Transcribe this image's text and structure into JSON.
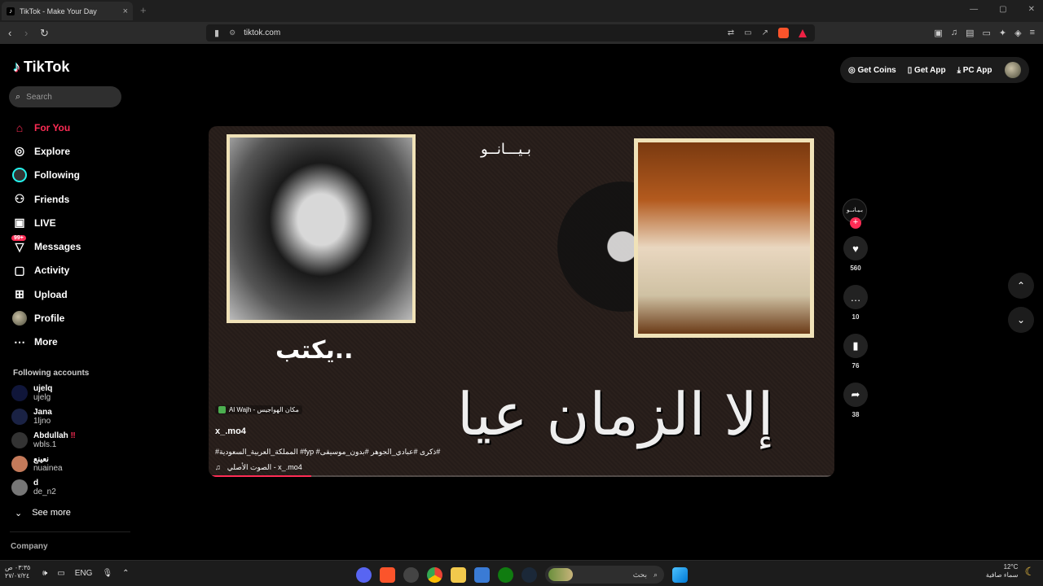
{
  "browser": {
    "tab_title": "TikTok - Make Your Day",
    "tab_favicon": "tiktok-icon",
    "url": "tiktok.com"
  },
  "site": {
    "logo_text": "TikTok",
    "search_placeholder": "Search",
    "nav": [
      {
        "label": "For You",
        "icon": "home-icon"
      },
      {
        "label": "Explore",
        "icon": "compass-icon"
      },
      {
        "label": "Following",
        "icon": "following-icon"
      },
      {
        "label": "Friends",
        "icon": "friends-icon"
      },
      {
        "label": "LIVE",
        "icon": "live-icon"
      },
      {
        "label": "Messages",
        "icon": "messages-icon",
        "badge": "99+"
      },
      {
        "label": "Activity",
        "icon": "activity-icon"
      },
      {
        "label": "Upload",
        "icon": "upload-icon"
      },
      {
        "label": "Profile",
        "icon": "profile-icon"
      },
      {
        "label": "More",
        "icon": "more-icon"
      }
    ],
    "following_heading": "Following accounts",
    "following": [
      {
        "name": "ujelq",
        "user": "ujelg"
      },
      {
        "name": "Jana",
        "user": "1ljno"
      },
      {
        "name": "Abdullah",
        "user": "wbls.1"
      },
      {
        "name": "نعينع",
        "user": "nuainea"
      },
      {
        "name": "d",
        "user": "de_n2"
      }
    ],
    "see_more": "See more",
    "company": "Company",
    "top_actions": {
      "coins": "Get Coins",
      "app": "Get App",
      "pc": "PC App"
    }
  },
  "video": {
    "overlay_small": "بـيـــانــو",
    "overlay_writes": "يكتب..",
    "overlay_big": "إلا الزمان عيا",
    "music_tag": "Al Wajh - مكان الهواجيس",
    "author": "x_.mo4",
    "caption": "#المملكة_العربية_السعودية #fyp #ذكرى #عبادي_الجوهر #بدون_موسيقى#",
    "sound": "الصوت الأصلي - x_.mo4",
    "progress": 0.16,
    "creator_badge": "بـيـانــو",
    "likes": "560",
    "comments": "10",
    "saves": "76",
    "shares": "38"
  },
  "taskbar": {
    "time": "٠٣:٣٥ ص",
    "date": "٢٧/٠٧/٢٤",
    "lang": "ENG",
    "search": "بحث",
    "temp": "12°C",
    "weather": "سماء صافية"
  }
}
